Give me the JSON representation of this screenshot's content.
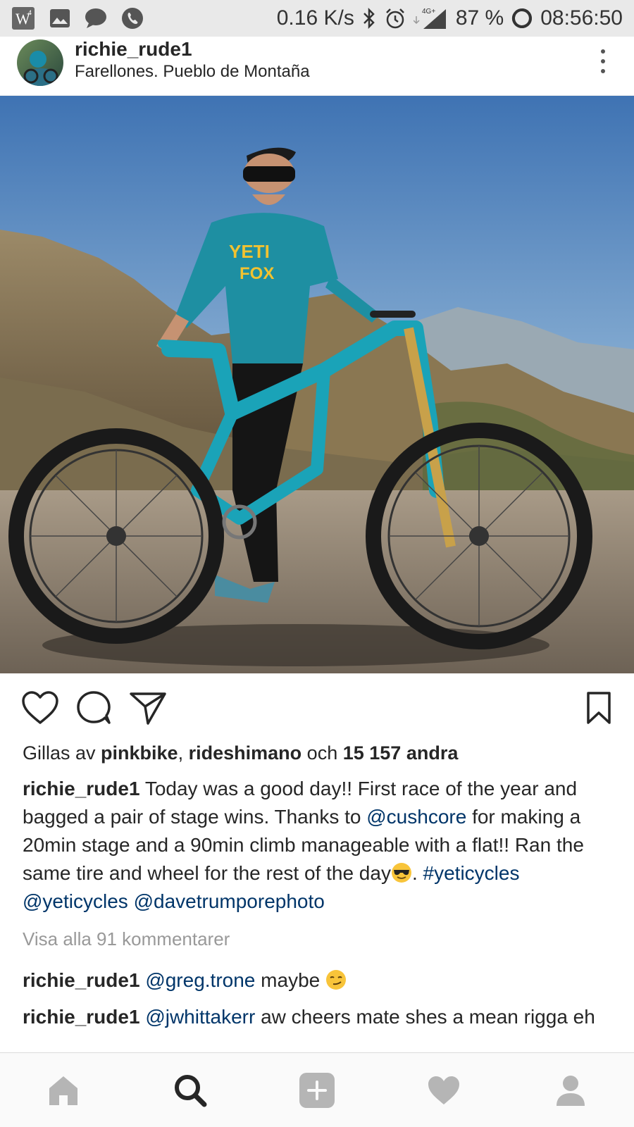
{
  "status_bar": {
    "network_speed": "0.16 K/s",
    "network_type": "4G+",
    "battery": "87 %",
    "time": "08:56:50"
  },
  "post": {
    "username": "richie_rude1",
    "location": "Farellones.  Pueblo de Montaña"
  },
  "likes": {
    "prefix": "Gillas av",
    "user1": "pinkbike",
    "sep": ",",
    "user2": "rideshimano",
    "conj": "och",
    "count": "15 157 andra"
  },
  "caption": {
    "username": "richie_rude1",
    "text1": "Today was a good day!! First race of the year and bagged a pair of stage wins. Thanks to",
    "mention1": "@cushcore",
    "text2": "for making a 20min stage and a 90min climb manageable with a flat!! Ran the same tire and wheel for the rest of the day",
    "text3": ".",
    "hashtag": "#yeticycles",
    "mention2": "@yeticycles",
    "mention3": "@davetrumporephoto"
  },
  "view_all_comments": "Visa alla 91 kommentarer",
  "comments": [
    {
      "username": "richie_rude1",
      "mention": "@greg.trone",
      "text": "maybe"
    },
    {
      "username": "richie_rude1",
      "mention": "@jwhittakerr",
      "text": "aw cheers mate shes a mean rigga eh"
    }
  ],
  "icons": {
    "status": [
      "w-app-icon",
      "gallery-icon",
      "chat-icon",
      "phone-icon",
      "bluetooth-icon",
      "alarm-icon",
      "signal-icon",
      "battery-icon"
    ],
    "actions": [
      "heart-icon",
      "comment-icon",
      "share-icon",
      "bookmark-icon"
    ],
    "nav": [
      "home-icon",
      "search-icon",
      "add-icon",
      "activity-icon",
      "profile-icon"
    ]
  },
  "colors": {
    "link": "#003569",
    "muted": "#999999",
    "text": "#262626",
    "nav_bg": "#fafafa"
  }
}
